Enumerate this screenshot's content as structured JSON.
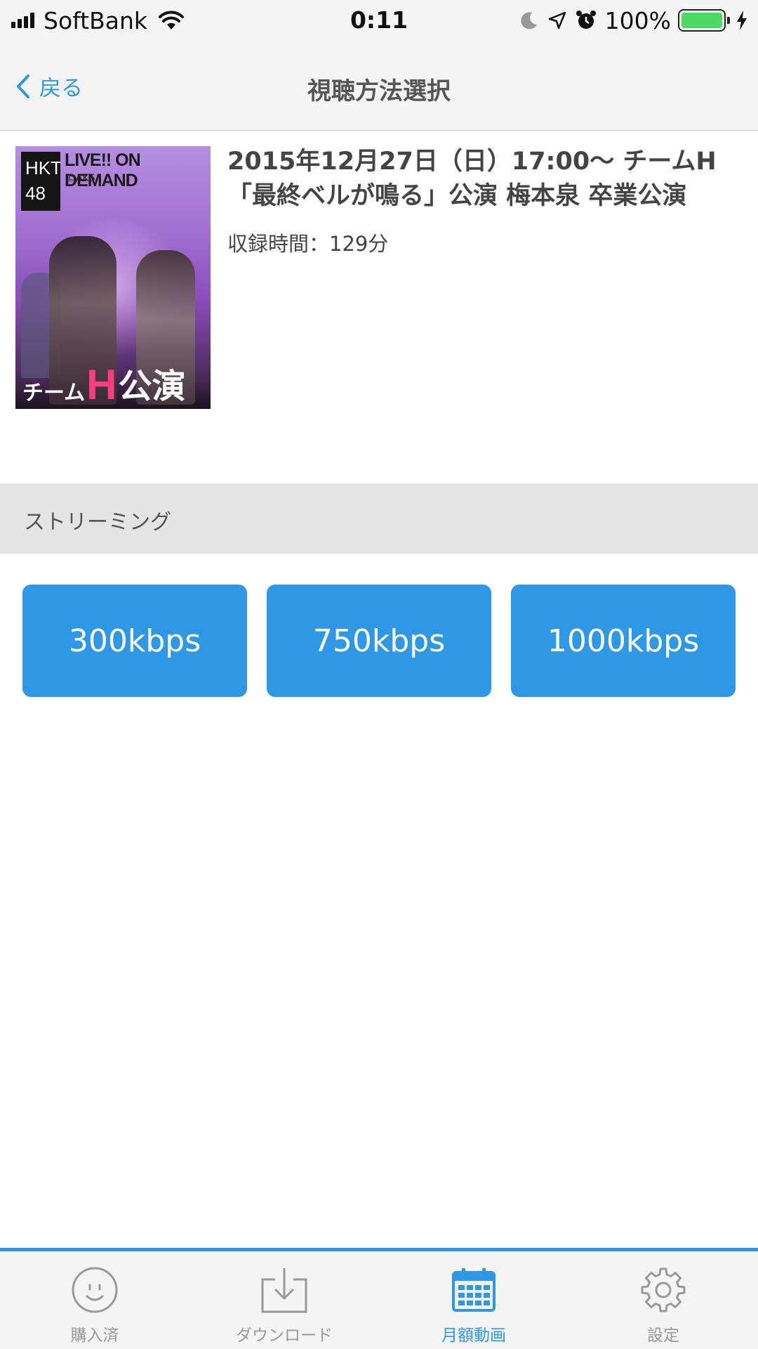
{
  "status_bar": {
    "carrier": "SoftBank",
    "time": "0:11",
    "battery_percent": "100%",
    "icons": [
      "signal-icon",
      "wifi-icon",
      "moon-icon",
      "location-arrow-icon",
      "alarm-icon",
      "battery-icon",
      "charging-bolt-icon"
    ],
    "battery_color": "#4cd964"
  },
  "nav": {
    "back_label": "戻る",
    "title": "視聴方法選択"
  },
  "video": {
    "thumbnail": {
      "header": "LIVE!! ON DEMAND",
      "copyright": "©AKS",
      "caption_prefix": "チーム",
      "caption_letter": "H",
      "caption_suffix": "公演"
    },
    "title": "2015年12月27日（日）17:00〜 チームH「最終ベルが鳴る」公演 梅本泉 卒業公演",
    "duration": "収録時間：129分"
  },
  "streaming": {
    "header": "ストリーミング",
    "options": [
      {
        "label": "300kbps"
      },
      {
        "label": "750kbps"
      },
      {
        "label": "1000kbps"
      }
    ]
  },
  "tabs": [
    {
      "label": "購入済",
      "icon": "smiley-icon",
      "active": false
    },
    {
      "label": "ダウンロード",
      "icon": "download-icon",
      "active": false
    },
    {
      "label": "月額動画",
      "icon": "calendar-icon",
      "active": true
    },
    {
      "label": "設定",
      "icon": "gear-icon",
      "active": false
    }
  ],
  "colors": {
    "accent": "#2e98e6",
    "bar_background": "#f4f4f4",
    "section_background": "#e4e4e4",
    "inactive_tab": "#999999",
    "thumbnail_caption_h": "#ff3d7f"
  }
}
